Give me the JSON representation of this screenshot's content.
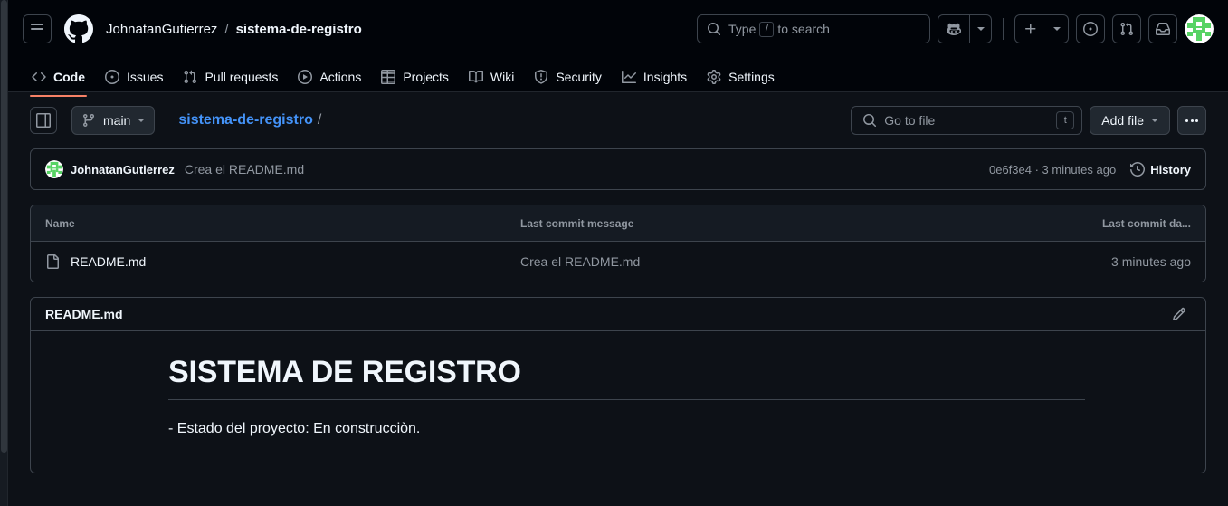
{
  "header": {
    "menu_label": "Open global navigation menu",
    "logo_name": "GitHub",
    "owner": "JohnatanGutierrez",
    "separator": "/",
    "repo": "sistema-de-registro",
    "search": {
      "prefix": "Type",
      "key": "/",
      "suffix": "to search"
    },
    "copilot_label": "Copilot",
    "create_new_label": "Create new...",
    "issues_label": "Your issues",
    "pull_requests_label": "Your pull requests",
    "inbox_label": "Notifications",
    "avatar_label": "Open user account menu"
  },
  "repo_nav": {
    "tabs": [
      {
        "label": "Code",
        "icon": "code-icon",
        "active": true
      },
      {
        "label": "Issues",
        "icon": "issue-opened-icon",
        "active": false
      },
      {
        "label": "Pull requests",
        "icon": "git-pull-request-icon",
        "active": false
      },
      {
        "label": "Actions",
        "icon": "play-icon",
        "active": false
      },
      {
        "label": "Projects",
        "icon": "table-icon",
        "active": false
      },
      {
        "label": "Wiki",
        "icon": "book-icon",
        "active": false
      },
      {
        "label": "Security",
        "icon": "shield-icon",
        "active": false
      },
      {
        "label": "Insights",
        "icon": "graph-icon",
        "active": false
      },
      {
        "label": "Settings",
        "icon": "gear-icon",
        "active": false
      }
    ]
  },
  "file_toolbar": {
    "sidebar_toggle_label": "Expand file tree",
    "branch": "main",
    "breadcrumb_repo": "sistema-de-registro",
    "breadcrumb_slash": "/",
    "go_to_file_placeholder": "Go to file",
    "go_to_file_key": "t",
    "add_file_label": "Add file",
    "more_options_label": "More options"
  },
  "latest_commit": {
    "author": "JohnatanGutierrez",
    "message": "Crea el README.md",
    "sha": "0e6f3e4",
    "separator": "·",
    "relative_time": "3 minutes ago",
    "meta": "0e6f3e4 · 3 minutes ago",
    "history_label": "History"
  },
  "file_table": {
    "columns": {
      "name": "Name",
      "message": "Last commit message",
      "date": "Last commit da..."
    },
    "rows": [
      {
        "icon": "file-icon",
        "name": "README.md",
        "message": "Crea el README.md",
        "date": "3 minutes ago"
      }
    ]
  },
  "readme": {
    "title": "README.md",
    "edit_label": "Edit README",
    "heading": "SISTEMA DE REGISTRO",
    "paragraph": "- Estado del proyecto: En construcciòn."
  },
  "colors": {
    "canvas": "#0d1117",
    "header_bg": "#010409",
    "border": "#3d444d",
    "accent_link": "#4493f8",
    "active_tab_underline": "#f78166",
    "muted_text": "#9198a1",
    "primary_text": "#f0f6fc",
    "avatar_green": "#57d364"
  }
}
